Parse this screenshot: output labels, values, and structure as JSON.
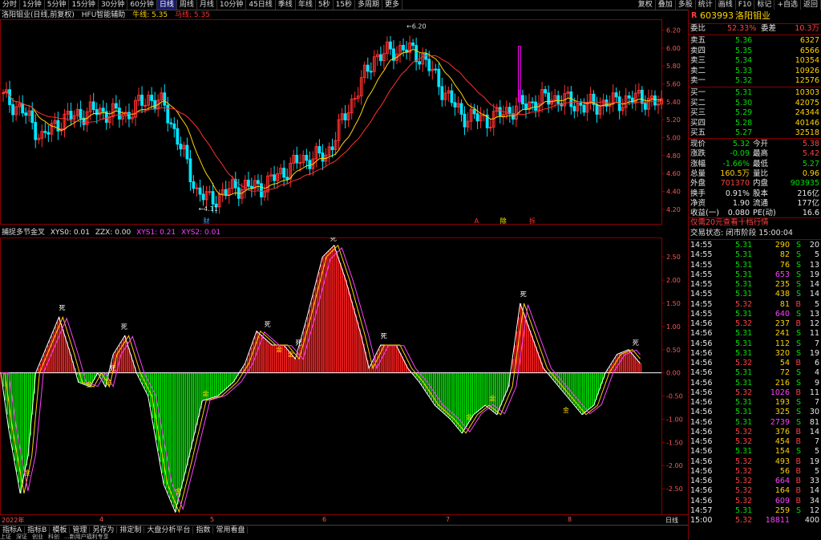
{
  "toolbar": {
    "items": [
      "分时",
      "1分钟",
      "5分钟",
      "15分钟",
      "30分钟",
      "60分钟",
      "日线",
      "周线",
      "月线",
      "10分钟",
      "45日线",
      "季线",
      "年线",
      "5秒",
      "15秒",
      "多周期",
      "更多"
    ],
    "active_index": 6,
    "right_items": [
      "复权",
      "叠加",
      "多股",
      "统计",
      "画线",
      "F10",
      "标记",
      "+自选",
      "返回"
    ]
  },
  "price_pane": {
    "title": "洛阳钼业(日线,前复权)",
    "indicator": "HFU智能辅助",
    "ma1_label": "牛线: 5.35",
    "ma2_label": "马线: 5.35",
    "high_label": "6.20",
    "low_label": "4.11",
    "axis": [
      "6.20",
      "6.00",
      "5.80",
      "5.60",
      "5.40",
      "5.20",
      "5.00",
      "4.80",
      "4.60",
      "4.40",
      "4.20"
    ],
    "markers": [
      "财",
      "A",
      "除",
      "拆"
    ],
    "colors": {
      "up": "#ff3030",
      "down": "#00e5ff",
      "ma_fast": "#ffd400",
      "ma_slow": "#ff3030",
      "highlight": "#ff00ff"
    }
  },
  "osc_pane": {
    "title": "捕捉多节金叉",
    "x1_label": "XYS0: 0.01",
    "x2_label": "ZZX: 0.00",
    "x3_label": "XYS1: 0.21",
    "x4_label": "XYS2: 0.01",
    "axis": [
      "2.50",
      "2.00",
      "1.50",
      "1.00",
      "0.50",
      "0.00",
      "-0.50",
      "-1.00",
      "-1.50",
      "-2.00",
      "-2.50"
    ],
    "tag_dead": "死",
    "tag_gold": "金",
    "colors": {
      "pos": "#ff2020",
      "neg": "#00e000",
      "line_a": "#ffffff",
      "line_b": "#ffd400",
      "line_c": "#ff40ff"
    }
  },
  "x_axis": {
    "start": "2022年",
    "labels": [
      "4",
      "5",
      "6",
      "7",
      "8"
    ],
    "period": "日线"
  },
  "quote": {
    "code": "603993",
    "name": "洛阳钼业",
    "prefix": "R",
    "webi_label": "委比",
    "webi": "52.33%",
    "weicha_label": "委差",
    "weicha": "10.3万",
    "asks": [
      {
        "label": "卖五",
        "price": "5.36",
        "vol": "6327"
      },
      {
        "label": "卖四",
        "price": "5.35",
        "vol": "6566"
      },
      {
        "label": "卖三",
        "price": "5.34",
        "vol": "10354"
      },
      {
        "label": "卖二",
        "price": "5.33",
        "vol": "10926"
      },
      {
        "label": "卖一",
        "price": "5.32",
        "vol": "12576"
      }
    ],
    "bids": [
      {
        "label": "买一",
        "price": "5.31",
        "vol": "10303"
      },
      {
        "label": "买二",
        "price": "5.30",
        "vol": "42075"
      },
      {
        "label": "买三",
        "price": "5.29",
        "vol": "24344"
      },
      {
        "label": "买四",
        "price": "5.28",
        "vol": "40146"
      },
      {
        "label": "买五",
        "price": "5.27",
        "vol": "32518"
      }
    ],
    "stats": [
      {
        "l1": "现价",
        "v1": "5.32",
        "l2": "今开",
        "v2": "5.38",
        "c1": "dn",
        "c2": "up"
      },
      {
        "l1": "涨跌",
        "v1": "-0.09",
        "l2": "最高",
        "v2": "5.42",
        "c1": "dn",
        "c2": "up"
      },
      {
        "l1": "涨幅",
        "v1": "-1.66%",
        "l2": "最低",
        "v2": "5.27",
        "c1": "dn",
        "c2": "dn"
      },
      {
        "l1": "总量",
        "v1": "160.5万",
        "l2": "量比",
        "v2": "0.96",
        "c1": "yl",
        "c2": "yl"
      },
      {
        "l1": "外盘",
        "v1": "701370",
        "l2": "内盘",
        "v2": "903935",
        "c1": "up",
        "c2": "dn"
      },
      {
        "l1": "换手",
        "v1": "0.91%",
        "l2": "股本",
        "v2": "216亿",
        "c1": "wh",
        "c2": "wh"
      },
      {
        "l1": "净资",
        "v1": "1.90",
        "l2": "流通",
        "v2": "177亿",
        "c1": "wh",
        "c2": "wh"
      },
      {
        "l1": "收益(一)",
        "v1": "0.080",
        "l2": "PE(动)",
        "v2": "16.6",
        "c1": "wh",
        "c2": "wh"
      }
    ],
    "promo": "仅需20元查看十档行情",
    "status": "交易状态: 闭市阶段 15:00:04",
    "ticks": [
      {
        "t": "14:55",
        "p": "5.31",
        "v": "290",
        "s": "S",
        "n": "20"
      },
      {
        "t": "14:55",
        "p": "5.31",
        "v": "82",
        "s": "S",
        "n": "5"
      },
      {
        "t": "14:55",
        "p": "5.31",
        "v": "76",
        "s": "S",
        "n": "13"
      },
      {
        "t": "14:55",
        "p": "5.31",
        "v": "653",
        "s": "S",
        "n": "19"
      },
      {
        "t": "14:55",
        "p": "5.31",
        "v": "235",
        "s": "S",
        "n": "14"
      },
      {
        "t": "14:55",
        "p": "5.31",
        "v": "438",
        "s": "S",
        "n": "14"
      },
      {
        "t": "14:55",
        "p": "5.32",
        "v": "81",
        "s": "B",
        "n": "5"
      },
      {
        "t": "14:55",
        "p": "5.31",
        "v": "640",
        "s": "S",
        "n": "13"
      },
      {
        "t": "14:56",
        "p": "5.32",
        "v": "237",
        "s": "B",
        "n": "12"
      },
      {
        "t": "14:56",
        "p": "5.31",
        "v": "241",
        "s": "S",
        "n": "11"
      },
      {
        "t": "14:56",
        "p": "5.31",
        "v": "112",
        "s": "S",
        "n": "7"
      },
      {
        "t": "14:56",
        "p": "5.31",
        "v": "320",
        "s": "S",
        "n": "19"
      },
      {
        "t": "14:56",
        "p": "5.32",
        "v": "54",
        "s": "B",
        "n": "6"
      },
      {
        "t": "14:56",
        "p": "5.31",
        "v": "72",
        "s": "S",
        "n": "4"
      },
      {
        "t": "14:56",
        "p": "5.31",
        "v": "216",
        "s": "S",
        "n": "9"
      },
      {
        "t": "14:56",
        "p": "5.32",
        "v": "1026",
        "s": "B",
        "n": "11"
      },
      {
        "t": "14:56",
        "p": "5.31",
        "v": "193",
        "s": "S",
        "n": "7"
      },
      {
        "t": "14:56",
        "p": "5.31",
        "v": "325",
        "s": "S",
        "n": "30"
      },
      {
        "t": "14:56",
        "p": "5.31",
        "v": "2739",
        "s": "S",
        "n": "81"
      },
      {
        "t": "14:56",
        "p": "5.32",
        "v": "376",
        "s": "B",
        "n": "14"
      },
      {
        "t": "14:56",
        "p": "5.32",
        "v": "454",
        "s": "B",
        "n": "7"
      },
      {
        "t": "14:56",
        "p": "5.31",
        "v": "154",
        "s": "S",
        "n": "5"
      },
      {
        "t": "14:56",
        "p": "5.32",
        "v": "493",
        "s": "B",
        "n": "19"
      },
      {
        "t": "14:56",
        "p": "5.32",
        "v": "56",
        "s": "B",
        "n": "5"
      },
      {
        "t": "14:56",
        "p": "5.32",
        "v": "664",
        "s": "B",
        "n": "33"
      },
      {
        "t": "14:56",
        "p": "5.32",
        "v": "164",
        "s": "B",
        "n": "14"
      },
      {
        "t": "14:56",
        "p": "5.32",
        "v": "609",
        "s": "B",
        "n": "34"
      },
      {
        "t": "14:57",
        "p": "5.31",
        "v": "259",
        "s": "S",
        "n": "12"
      },
      {
        "t": "15:00",
        "p": "5.32",
        "v": "18811",
        "s": "",
        "n": "400"
      }
    ]
  },
  "bottom_bar": [
    "指标A",
    "指标B",
    "模板",
    "管理",
    "另存为",
    "排定制",
    "大盘分析平台",
    "指数",
    "常用看盘"
  ],
  "status_bar": [
    "上证",
    "深证",
    "创业",
    "科创",
    "...新用户福利专享"
  ]
}
